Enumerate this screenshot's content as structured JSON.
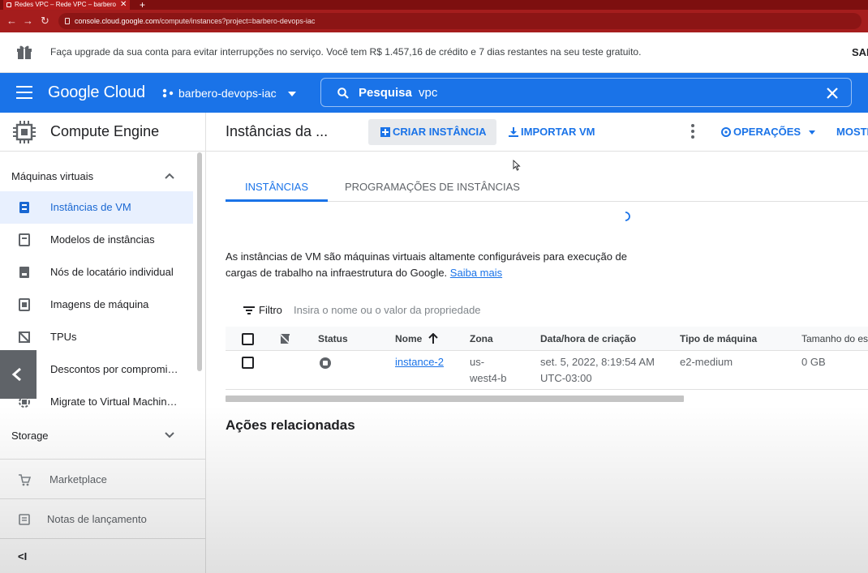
{
  "browser": {
    "tab_title": "Redes VPC – Rede VPC – barbero",
    "new_tab": "+",
    "close": "✕",
    "back": "←",
    "forward": "→",
    "reload": "↻",
    "url_host": "console.cloud.google.com",
    "url_path": "/compute/instances?project=barbero-devops-iac"
  },
  "banner": {
    "text": "Faça upgrade da sua conta para evitar interrupções no serviço. Você tem R$ 1.457,16 de crédito e 7 dias restantes na seu teste gratuito.",
    "action_label": "SAI"
  },
  "header": {
    "logo": "Google Cloud",
    "project": "barbero-devops-iac",
    "search_label": "Pesquisa",
    "search_value": "vpc"
  },
  "sidebar": {
    "product_title": "Compute Engine",
    "section_vm": "Máquinas virtuais",
    "items": [
      {
        "label": "Instâncias de VM",
        "icon": "vm-instance-icon"
      },
      {
        "label": "Modelos de instâncias",
        "icon": "template-icon"
      },
      {
        "label": "Nós de locatário individual",
        "icon": "sole-tenant-icon"
      },
      {
        "label": "Imagens de máquina",
        "icon": "machine-image-icon"
      },
      {
        "label": "TPUs",
        "icon": "tpu-icon"
      },
      {
        "label": "Descontos por compromi…",
        "icon": "discount-icon"
      },
      {
        "label": "Migrate to Virtual Machin…",
        "icon": "migrate-icon"
      }
    ],
    "section_storage": "Storage",
    "footer": [
      {
        "label": "Marketplace",
        "icon": "cart-icon"
      },
      {
        "label": "Notas de lançamento",
        "icon": "release-notes-icon"
      }
    ],
    "collapse_symbol": "<I"
  },
  "toolbar": {
    "title": "Instâncias da ...",
    "create_label": "CRIAR INSTÂNCIA",
    "import_label": "IMPORTAR VM",
    "operations_label": "OPERAÇÕES",
    "show_label": "MOSTR"
  },
  "tabs": [
    "INSTÂNCIAS",
    "PROGRAMAÇÕES DE INSTÂNCIAS"
  ],
  "intro": {
    "text": "As instâncias de VM são máquinas virtuais altamente configuráveis para execução de cargas de trabalho na infraestrutura do Google.",
    "link": "Saiba mais"
  },
  "filter": {
    "label": "Filtro",
    "placeholder": "Insira o nome ou o valor da propriedade"
  },
  "table": {
    "columns": [
      "Status",
      "Nome",
      "Zona",
      "Data/hora de criação",
      "Tipo de máquina",
      "Tamanho do es"
    ],
    "rows": [
      {
        "name": "instance-2",
        "zone_line1": "us-",
        "zone_line2": "west4-b",
        "created_line1": "set. 5, 2022, 8:19:54 AM",
        "created_line2": "UTC-03:00",
        "machine_type": "e2-medium",
        "size": "0 GB"
      }
    ]
  },
  "related": {
    "title": "Ações relacionadas"
  },
  "colors": {
    "brand_blue": "#1a73e8",
    "browser_red": "#a51d1d",
    "active_nav_bg": "#e8f0fe"
  }
}
